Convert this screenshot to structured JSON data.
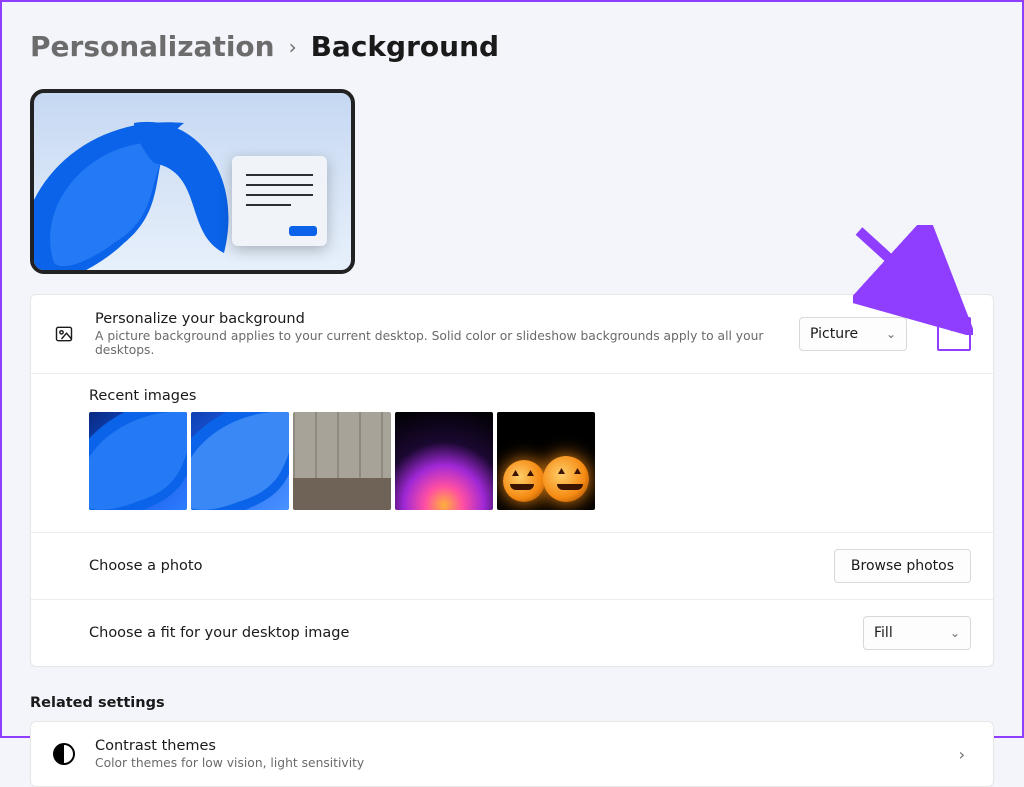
{
  "breadcrumb": {
    "parent": "Personalization",
    "current": "Background"
  },
  "personalize": {
    "title": "Personalize your background",
    "subtitle": "A picture background applies to your current desktop. Solid color or slideshow backgrounds apply to all your desktops.",
    "select_value": "Picture"
  },
  "recent": {
    "label": "Recent images"
  },
  "choose_photo": {
    "label": "Choose a photo",
    "button": "Browse photos"
  },
  "choose_fit": {
    "label": "Choose a fit for your desktop image",
    "select_value": "Fill"
  },
  "related": {
    "heading": "Related settings",
    "contrast": {
      "title": "Contrast themes",
      "subtitle": "Color themes for low vision, light sensitivity"
    }
  },
  "colors": {
    "accent": "#8f3eff"
  }
}
